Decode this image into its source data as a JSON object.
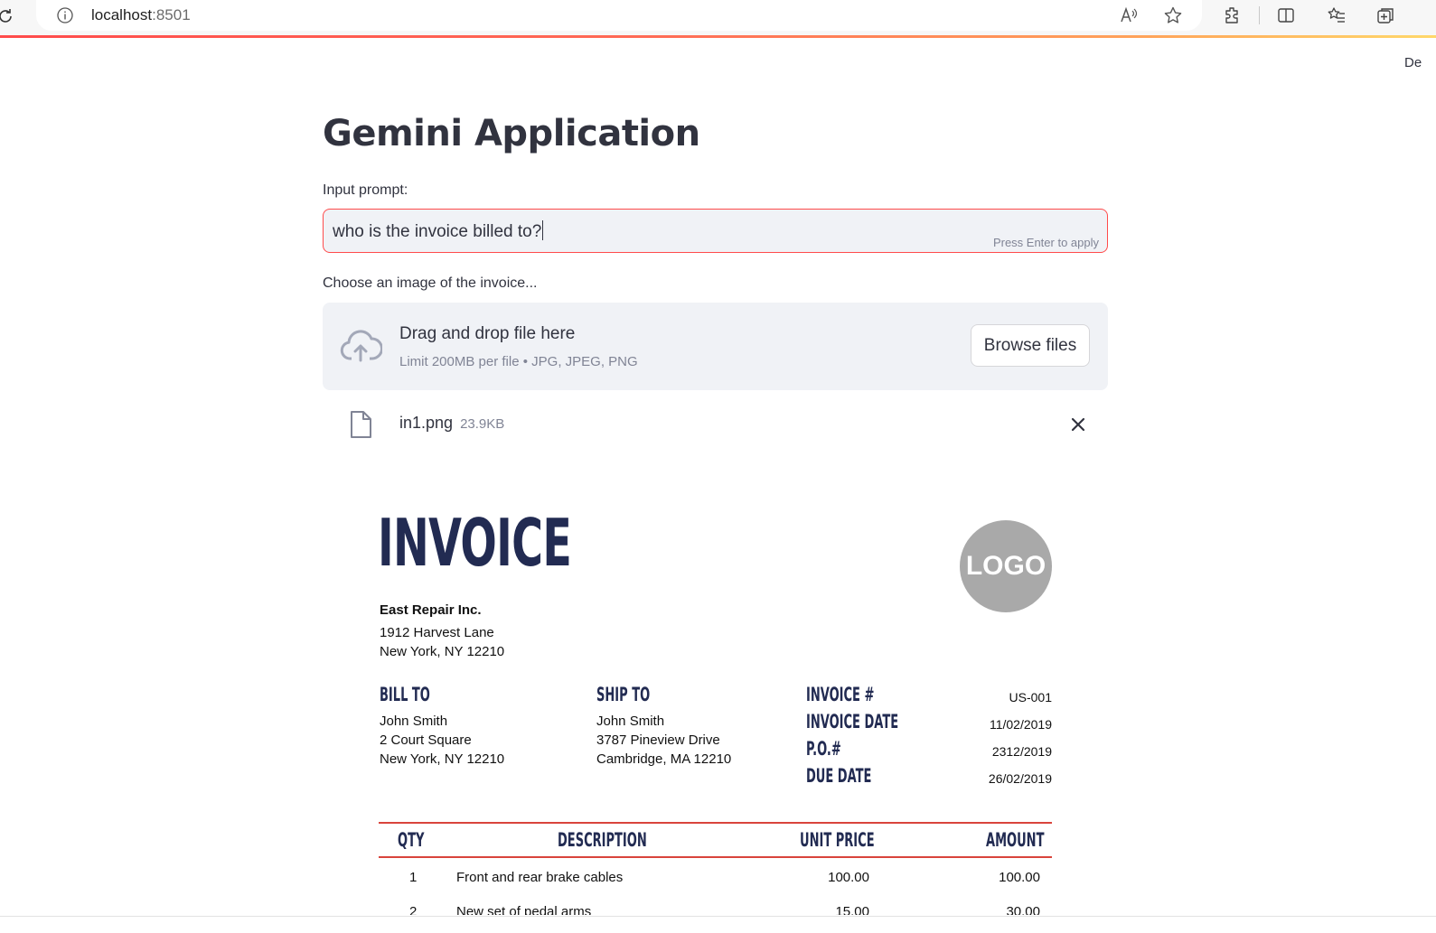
{
  "browser": {
    "url_host": "localhost",
    "url_port": ":8501",
    "deploy_fragment": "De"
  },
  "app": {
    "title": "Gemini Application",
    "prompt": {
      "label": "Input prompt:",
      "value": "who is the invoice billed to?",
      "hint": "Press Enter to apply"
    },
    "uploader": {
      "label": "Choose an image of the invoice...",
      "title": "Drag and drop file here",
      "limit": "Limit 200MB per file • JPG, JPEG, PNG",
      "browse_label": "Browse files",
      "file": {
        "name": "in1.png",
        "size": "23.9KB"
      }
    }
  },
  "invoice": {
    "heading": "INVOICE",
    "logo": "LOGO",
    "company": {
      "name": "East Repair Inc.",
      "street": "1912 Harvest Lane",
      "city": "New York, NY 12210"
    },
    "bill_to": {
      "label": "BILL TO",
      "name": "John Smith",
      "street": "2 Court Square",
      "city": "New York, NY 12210"
    },
    "ship_to": {
      "label": "SHIP TO",
      "name": "John Smith",
      "street": "3787 Pineview Drive",
      "city": "Cambridge, MA 12210"
    },
    "meta": [
      {
        "label": "INVOICE #",
        "value": "US-001"
      },
      {
        "label": "INVOICE DATE",
        "value": "11/02/2019"
      },
      {
        "label": "P.O.#",
        "value": "2312/2019"
      },
      {
        "label": "DUE DATE",
        "value": "26/02/2019"
      }
    ],
    "table": {
      "headers": {
        "qty": "QTY",
        "description": "DESCRIPTION",
        "unit_price": "UNIT PRICE",
        "amount": "AMOUNT"
      },
      "rows": [
        {
          "qty": "1",
          "description": "Front and rear brake cables",
          "unit_price": "100.00",
          "amount": "100.00"
        },
        {
          "qty": "2",
          "description": "New set of pedal arms",
          "unit_price": "15.00",
          "amount": "30.00"
        }
      ]
    }
  }
}
